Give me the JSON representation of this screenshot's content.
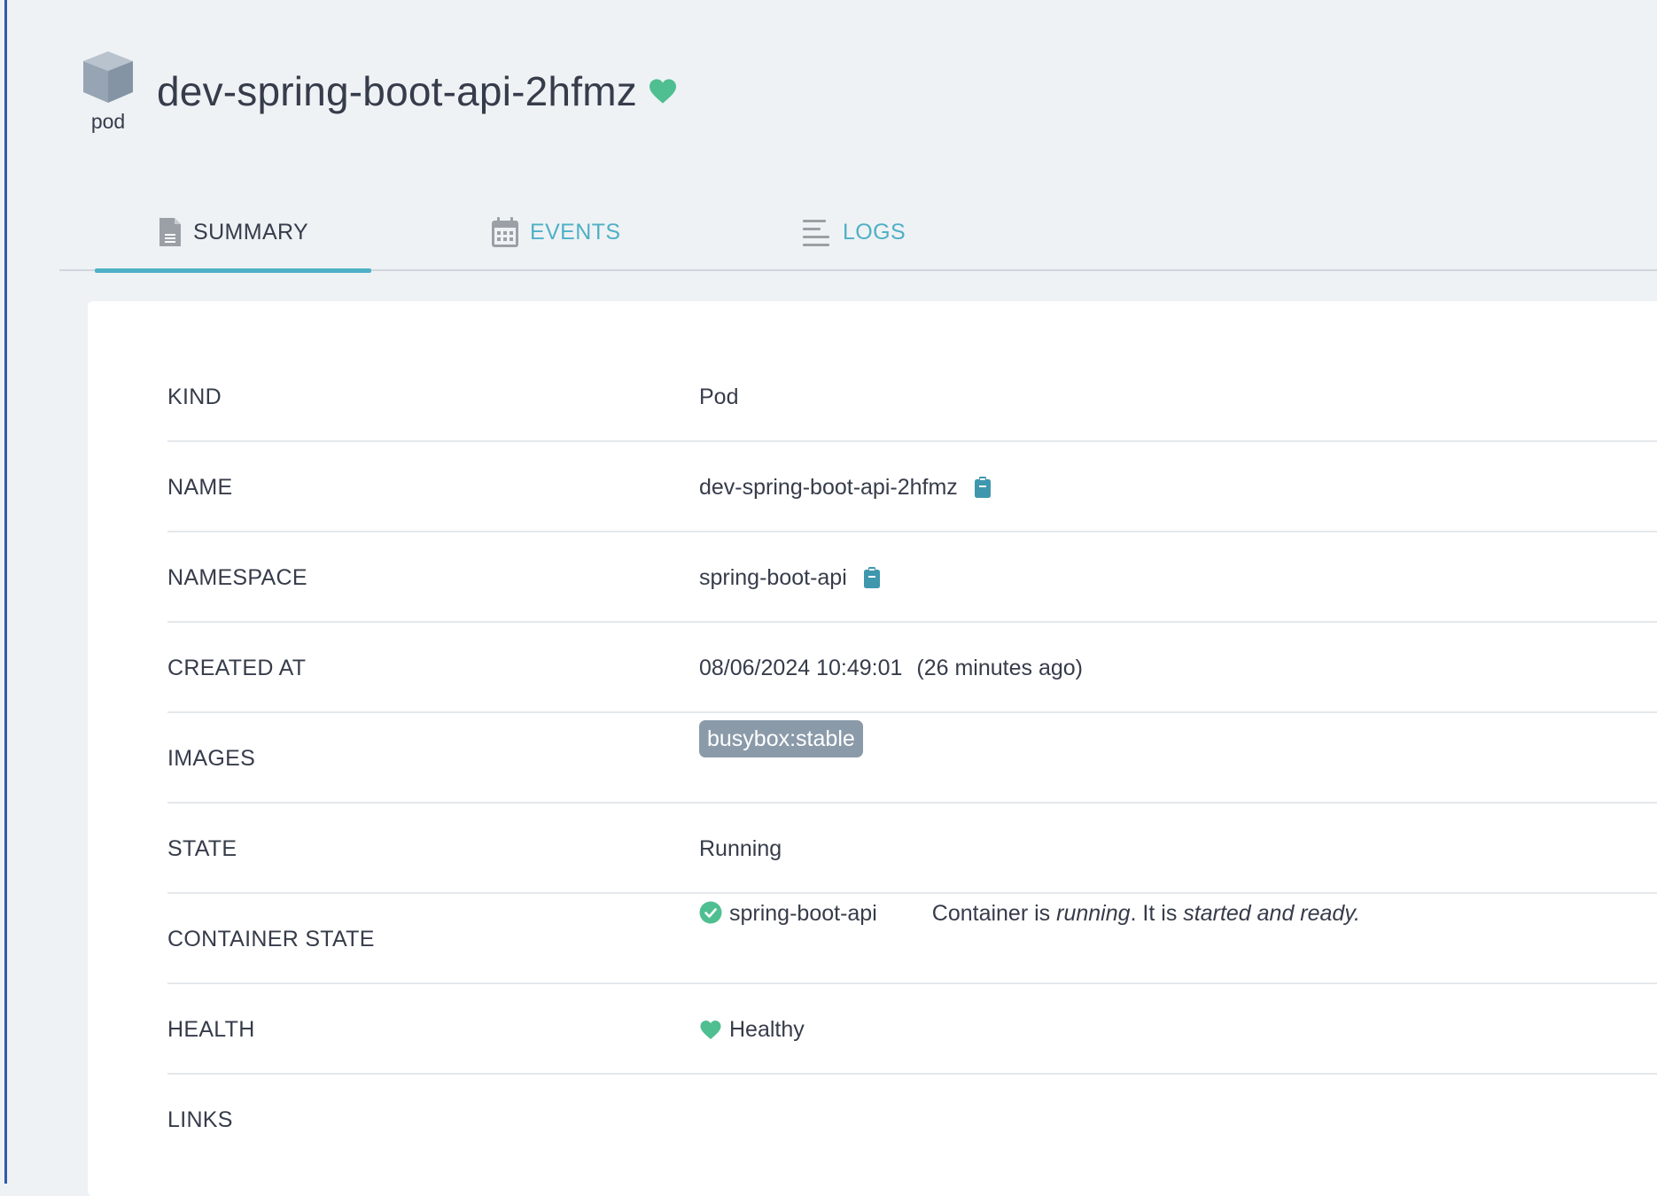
{
  "header": {
    "kind_label": "pod",
    "title": "dev-spring-boot-api-2hfmz",
    "health_icon": "heart-icon",
    "health_color": "#4fbf91"
  },
  "tabs": [
    {
      "label": "SUMMARY",
      "icon": "file-icon",
      "active": true
    },
    {
      "label": "EVENTS",
      "icon": "calendar-icon",
      "active": false
    },
    {
      "label": "LOGS",
      "icon": "lines-icon",
      "active": false
    }
  ],
  "summary": {
    "kind": {
      "label": "KIND",
      "value": "Pod"
    },
    "name": {
      "label": "NAME",
      "value": "dev-spring-boot-api-2hfmz",
      "copy_icon": "clipboard-icon"
    },
    "namespace": {
      "label": "NAMESPACE",
      "value": "spring-boot-api",
      "copy_icon": "clipboard-icon"
    },
    "created_at": {
      "label": "CREATED AT",
      "value": "08/06/2024 10:49:01",
      "relative": "(26 minutes ago)"
    },
    "images": {
      "label": "IMAGES",
      "items": [
        "busybox:stable"
      ]
    },
    "state": {
      "label": "STATE",
      "value": "Running"
    },
    "container_state": {
      "label": "CONTAINER STATE",
      "container": "spring-boot-api",
      "msg_prefix": "Container is ",
      "msg_running": "running",
      "msg_mid": ". It is ",
      "msg_ready": "started and ready."
    },
    "health": {
      "label": "HEALTH",
      "value": "Healthy"
    },
    "links": {
      "label": "LINKS"
    }
  },
  "colors": {
    "accent": "#4fb0c6",
    "copy_icon": "#3e97ad",
    "healthy": "#4fbf91",
    "chip_bg": "#8b9aa9"
  }
}
